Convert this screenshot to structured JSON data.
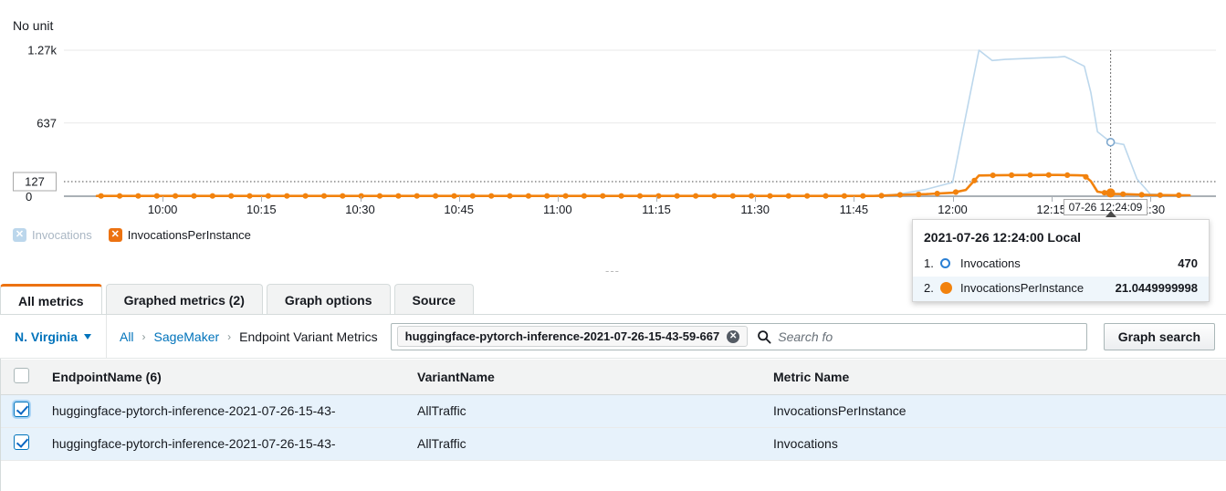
{
  "chart": {
    "unit_label": "No unit",
    "ellipsis": "---",
    "threshold_label": "127",
    "zero_label": "0",
    "cursor_badge": "07-26 12:24:09"
  },
  "chart_data": {
    "type": "line",
    "title": "",
    "xlabel": "",
    "ylabel": "No unit",
    "grid": true,
    "ylim": [
      0,
      1270
    ],
    "ytick_labels": [
      "1.27k",
      "637",
      "0"
    ],
    "ytick_values": [
      1270,
      637,
      0
    ],
    "xtick_labels": [
      "10:00",
      "10:15",
      "10:30",
      "10:45",
      "11:00",
      "11:15",
      "11:30",
      "11:45",
      "12:00",
      "12:15",
      "12:30"
    ],
    "threshold": 127,
    "cursor_x_label": "2021-07-26 12:24:00",
    "legend_position": "below",
    "series": [
      {
        "name": "Invocations",
        "color": "#bcd7ec",
        "enabled": false,
        "marker": "none",
        "x": [
          "09:50",
          "11:48",
          "11:52",
          "11:56",
          "12:00",
          "12:02",
          "12:04",
          "12:06",
          "12:08",
          "12:10",
          "12:12",
          "12:14",
          "12:16",
          "12:17",
          "12:18",
          "12:19",
          "12:20",
          "12:21",
          "12:22",
          "12:24",
          "12:26",
          "12:28",
          "12:30",
          "12:36"
        ],
        "values": [
          0,
          0,
          20,
          60,
          120,
          700,
          1270,
          1180,
          1190,
          1195,
          1200,
          1205,
          1210,
          1215,
          1190,
          1160,
          1130,
          900,
          560,
          470,
          450,
          150,
          20,
          0
        ]
      },
      {
        "name": "InvocationsPerInstance",
        "color": "#f2820d",
        "enabled": true,
        "marker": "circle",
        "x": [
          "09:50",
          "11:48",
          "11:52",
          "11:56",
          "12:00",
          "12:02",
          "12:04",
          "12:06",
          "12:08",
          "12:10",
          "12:12",
          "12:14",
          "12:16",
          "12:17",
          "12:18",
          "12:19",
          "12:20",
          "12:21",
          "12:22",
          "12:24",
          "12:26",
          "12:28",
          "12:30",
          "12:36"
        ],
        "values": [
          2,
          2,
          12,
          18,
          30,
          55,
          180,
          182,
          183,
          184,
          184,
          185,
          185,
          184,
          183,
          182,
          180,
          130,
          40,
          21,
          18,
          14,
          10,
          8
        ]
      }
    ]
  },
  "legend": [
    {
      "label": "Invocations",
      "color": "#bcd7ec",
      "glyph": "✕",
      "active": false
    },
    {
      "label": "InvocationsPerInstance",
      "color": "#ec7211",
      "glyph": "✕",
      "active": true
    }
  ],
  "tooltip": {
    "title": "2021-07-26 12:24:00 Local",
    "rows": [
      {
        "index": "1.",
        "name": "Invocations",
        "value": "470",
        "marker": "ring"
      },
      {
        "index": "2.",
        "name": "InvocationsPerInstance",
        "value": "21.0449999998",
        "marker": "dot"
      }
    ]
  },
  "tabs": [
    {
      "label": "All metrics",
      "active": true
    },
    {
      "label": "Graphed metrics (2)",
      "active": false
    },
    {
      "label": "Graph options",
      "active": false
    },
    {
      "label": "Source",
      "active": false
    }
  ],
  "toolbar": {
    "region": "N. Virginia",
    "breadcrumb": [
      {
        "label": "All",
        "link": true
      },
      {
        "label": "SageMaker",
        "link": true
      },
      {
        "label": "Endpoint Variant Metrics",
        "link": false
      }
    ],
    "breadcrumb_separator": "›",
    "chip": {
      "label": "huggingface-pytorch-inference-2021-07-26-15-43-59-667",
      "remove_glyph": "✕"
    },
    "search_placeholder": "Search fo",
    "graph_search_label": "Graph search"
  },
  "table": {
    "columns": [
      "EndpointName (6)",
      "VariantName",
      "Metric Name"
    ],
    "rows": [
      {
        "checked": true,
        "endpoint": "huggingface-pytorch-inference-2021-07-26-15-43-",
        "variant": "AllTraffic",
        "metric": "InvocationsPerInstance"
      },
      {
        "checked": true,
        "endpoint": "huggingface-pytorch-inference-2021-07-26-15-43-",
        "variant": "AllTraffic",
        "metric": "Invocations"
      }
    ]
  }
}
